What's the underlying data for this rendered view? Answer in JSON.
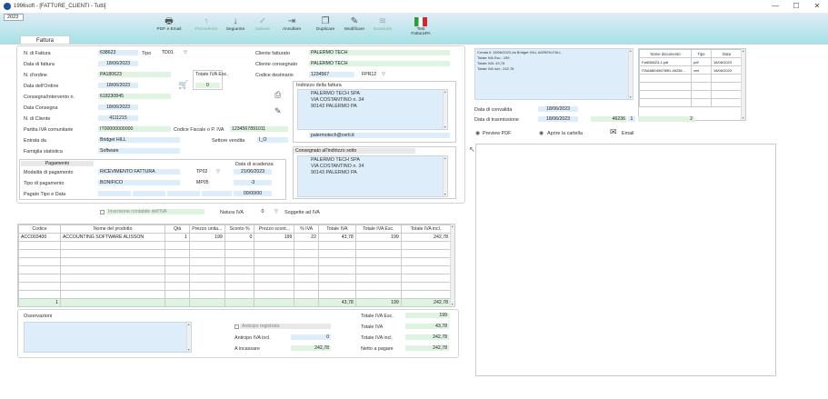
{
  "window": {
    "title": "1996soft - [FATTURE_CLIENTI - Tutti]",
    "year": "2023",
    "minimize": "—",
    "maximize": "☐",
    "close": "✕"
  },
  "toolbar": [
    {
      "label": "PDF e Email",
      "icon": "printer-icon",
      "glyph": "🖶",
      "enabled": true
    },
    {
      "label": "Precedente",
      "icon": "arrow-up-icon",
      "glyph": "↑",
      "enabled": false
    },
    {
      "label": "Seguente",
      "icon": "arrow-down-icon",
      "glyph": "↓",
      "enabled": true
    },
    {
      "label": "Salvare",
      "icon": "check-circle-icon",
      "glyph": "✓",
      "enabled": false
    },
    {
      "label": "Annullare",
      "icon": "exit-icon",
      "glyph": "⇥",
      "enabled": true
    },
    {
      "label": "Duplicare",
      "icon": "duplicate-icon",
      "glyph": "❐",
      "enabled": true
    },
    {
      "label": "Modificare",
      "icon": "edit-icon",
      "glyph": "✎",
      "enabled": true
    },
    {
      "label": "Incassare",
      "icon": "coins-icon",
      "glyph": "≋",
      "enabled": false
    },
    {
      "label": "Test FatturaPA",
      "icon": "italy-flag-icon",
      "glyph": "",
      "enabled": true
    }
  ],
  "tab": "Fattura",
  "fields": {
    "n_fattura_label": "N. di Fattura",
    "n_fattura": "638623",
    "tipo_label": "Tipo",
    "tipo": "TD01",
    "data_fattura_label": "Data di fattura",
    "data_fattura": "18/06/2023",
    "n_ordine_label": "N. d'ordine",
    "n_ordine": "PA180623",
    "totale_iva_esc_label": "Totale IVA Esc.",
    "totale_iva_esc": "0",
    "data_ordine_label": "Data dell'Ordine",
    "data_ordine": "18/06/2023",
    "consegna_label": "Consegna/Intervento n.",
    "consegna": "618230845",
    "data_consegna_label": "Data Consegna",
    "data_consegna": "18/06/2023",
    "n_cliente_label": "N. di Cliente",
    "n_cliente": "4111215",
    "partita_iva_label": "Partita IVA comunitarie",
    "partita_iva": "IT00000000000",
    "cf_label": "Codice Fiscale o P. IVA",
    "cf": "1234567891011",
    "entrata_label": "Entrata da",
    "entrata": "Bridget HILL",
    "settore_label": "Settore vendita",
    "settore": "I_O",
    "famiglia_label": "Famiglia statistica",
    "famiglia": "Software",
    "cliente_fatturato_label": "Cliente fatturato",
    "cliente_fatturato": "PALERMO TECH",
    "cliente_consegnato_label": "Cliente consegnato",
    "cliente_consegnato": "PALERMO TECH",
    "codice_destinario_label": "Codice destinario",
    "codice_destinario": "1234567",
    "formato": "FPR12",
    "indirizzo_fattura_label": "Indirizzo della fattura",
    "indirizzo_fattura": [
      "PALERMO TECH SPA",
      "VIA COSTANTINO n. 34",
      "90143 PALERMO PA"
    ],
    "email": "palermotech@certi.it",
    "consegnato_label": "Consegnato all'indirizzo sotto",
    "indirizzo_consegna": [
      "PALERMO TECH SPA",
      "VIA COSTANTINO n. 34",
      "90143 PALERMO PA"
    ]
  },
  "pagamento": {
    "title": "Pagamento",
    "data_scadenza_label": "Data di scadenza",
    "modalita_label": "Modalità di pagamento",
    "modalita": "RICEVIMENTO FATTURA",
    "code": "TP02",
    "data_scadenza": "21/06/2023",
    "tipo_label": "Tipo di pagamento",
    "tipo": "BONIFICO",
    "mp": "MP05",
    "giorni": "-3",
    "pagato_label": "Pagato Tipo e Data",
    "pagato_data": "00/00/00"
  },
  "iva_row": {
    "inversione_label": "Inversione contabile dell'IVA",
    "natura_label": "Natura IVA",
    "natura": "0",
    "soggette": "Soggette ad IVA"
  },
  "table": {
    "headers": [
      "Codice",
      "Nome del prodotto",
      "Qtà",
      "Prezzo unita...",
      "Sconto %",
      "Prezzo scont...",
      "% IVA",
      "Totale IVA",
      "Totale IVA Esc.",
      "Totale IVA incl."
    ],
    "rows": [
      [
        "ACC003400",
        "ACCOUNTING SOFTWARE ALISSON",
        "1",
        "199",
        "0",
        "199",
        "22",
        "43,78",
        "199",
        "242,78"
      ]
    ],
    "totals": {
      "count": "1",
      "iva": "43,78",
      "esc": "199",
      "incl": "242,78"
    }
  },
  "footer": {
    "osservazioni_label": "Osservazioni",
    "anticipo_registrato_label": "Anticipo registrato",
    "anticipo_iva_label": "Anticipo IVA incl.",
    "anticipo_iva": "0",
    "incassare_label": "A incassare",
    "incassare": "242,78",
    "tot_esc_label": "Totale IVA Esc.",
    "tot_esc": "199",
    "tot_iva_label": "Totale IVA",
    "tot_iva": "43,78",
    "tot_incl_label": "Totale IVA incl.",
    "tot_incl": "242,78",
    "netto_label": "Netto a pagare",
    "netto": "242,78"
  },
  "right": {
    "log": [
      "Creata il: 18/06/2023 da Bridget HILL ADRIEN-FALL",
      "Totale IVA Esc.: 199",
      "Totale IVA: 43,78",
      "Totale IVA incl.: 242,78"
    ],
    "docs_headers": [
      "Nome documento",
      "Tipo",
      "Data"
    ],
    "docs": [
      [
        "Fat638623-1.pdf",
        "pdf",
        "18/06/2023"
      ],
      [
        "ITAA86D456789D-46236...",
        "xml",
        "18/06/2023"
      ]
    ],
    "convalida_label": "Data di convalida",
    "convalida": "18/06/2023",
    "trasmissione_label": "Data di trasmissione",
    "trasmissione": "18/06/2023",
    "prog": "46236",
    "prog2": "1",
    "count": "2",
    "preview": "Preview PDF",
    "cartella": "Aprire la cartella",
    "email": "Email"
  }
}
